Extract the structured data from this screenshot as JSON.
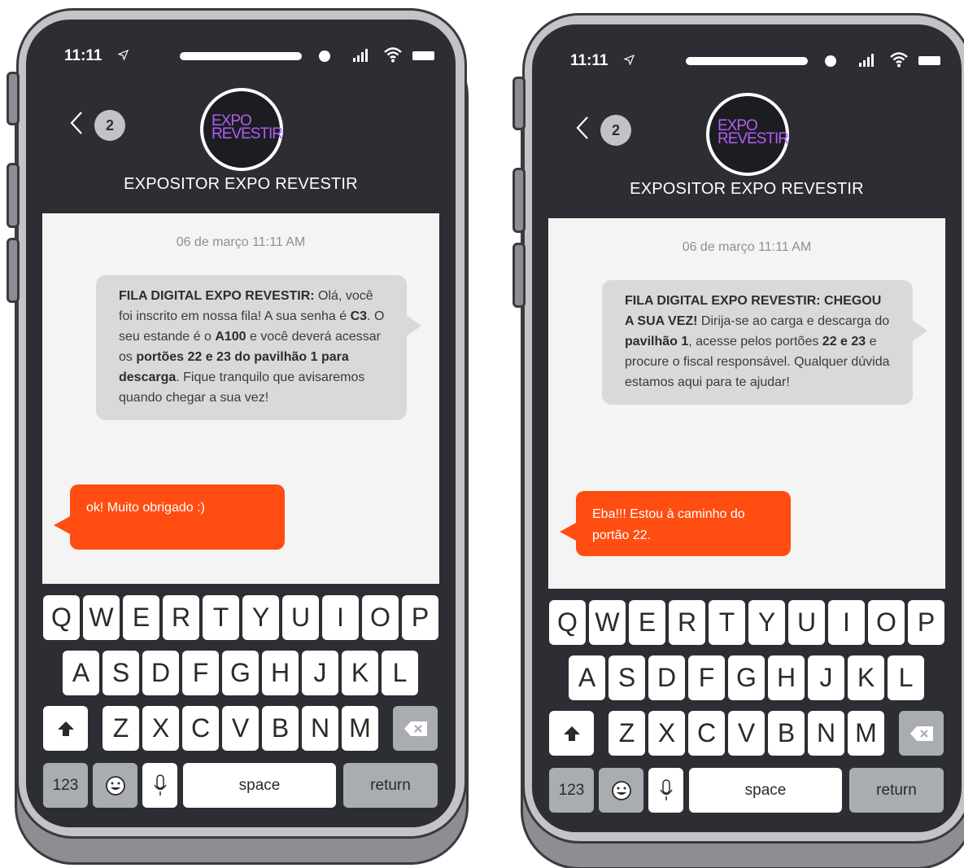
{
  "phones": [
    {
      "status": {
        "time": "11:11"
      },
      "header": {
        "badge": "2",
        "logo_line1": "EXPO",
        "logo_line2": "REVESTIR",
        "contact": "EXPOSITOR EXPO REVESTIR"
      },
      "chat": {
        "date": "06 de março 11:11 AM",
        "incoming": [
          {
            "text": "FILA DIGITAL EXPO REVESTIR:",
            "bold": true
          },
          {
            "text": " Olá, você foi inscrito em nossa fila!  A sua senha é ",
            "bold": false
          },
          {
            "text": "C3",
            "bold": true
          },
          {
            "text": ". O seu estande é o ",
            "bold": false
          },
          {
            "text": "A100",
            "bold": true
          },
          {
            "text": " e você deverá acessar os ",
            "bold": false
          },
          {
            "text": "portões 22 e 23 do pavilhão 1 para descarga",
            "bold": true
          },
          {
            "text": ". Fique tranquilo que avisaremos quando chegar a sua vez!",
            "bold": false
          }
        ],
        "outgoing": "ok! Muito obrigado :)"
      }
    },
    {
      "status": {
        "time": "11:11"
      },
      "header": {
        "badge": "2",
        "logo_line1": "EXPO",
        "logo_line2": "REVESTIR",
        "contact": "EXPOSITOR EXPO REVESTIR"
      },
      "chat": {
        "date": "06 de março 11:11 AM",
        "incoming": [
          {
            "text": "FILA DIGITAL EXPO REVESTIR: CHEGOU A SUA VEZ!",
            "bold": true
          },
          {
            "text": " Dirija-se ao carga e descarga do ",
            "bold": false
          },
          {
            "text": "pavilhão 1",
            "bold": true
          },
          {
            "text": ", acesse pelos portões ",
            "bold": false
          },
          {
            "text": "22 e 23",
            "bold": true
          },
          {
            "text": " e procure o fiscal responsável. Qualquer dúvida estamos aqui para te ajudar!",
            "bold": false
          }
        ],
        "outgoing": "Eba!!! Estou à caminho do portão 22."
      }
    }
  ],
  "keyboard": {
    "row1": [
      "Q",
      "W",
      "E",
      "R",
      "T",
      "Y",
      "U",
      "I",
      "O",
      "P"
    ],
    "row2": [
      "A",
      "S",
      "D",
      "F",
      "G",
      "H",
      "J",
      "K",
      "L"
    ],
    "row3": [
      "Z",
      "X",
      "C",
      "V",
      "B",
      "N",
      "M"
    ],
    "numbers_label": "123",
    "space_label": "space",
    "return_label": "return",
    "icons": [
      "shift-icon",
      "backspace-icon",
      "emoji-icon",
      "mic-icon"
    ]
  },
  "colors": {
    "screen": "#2c2e33",
    "chat_background": "#f4f4f4",
    "incoming_bubble": "#d9d9d9",
    "outgoing_bubble": "#ff4d12",
    "logo_accent": "#b05ef2",
    "phone_frame": "#c3c4c8"
  }
}
